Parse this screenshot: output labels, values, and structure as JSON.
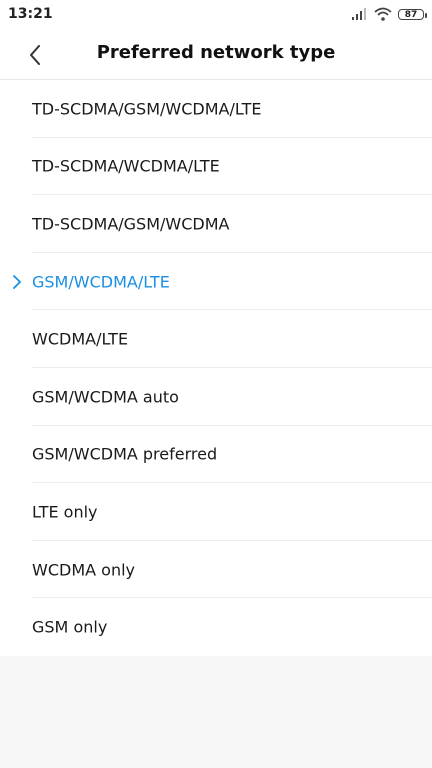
{
  "status_bar": {
    "time": "13:21",
    "battery": "87",
    "signal_icon": "signal-bars-icon",
    "wifi_icon": "wifi-icon"
  },
  "header": {
    "title": "Preferred network type",
    "back_icon": "chevron-left-icon"
  },
  "accent_color": "#1a8fe3",
  "network_types": [
    {
      "label": "TD-SCDMA/GSM/WCDMA/LTE",
      "selected": false
    },
    {
      "label": "TD-SCDMA/WCDMA/LTE",
      "selected": false
    },
    {
      "label": "TD-SCDMA/GSM/WCDMA",
      "selected": false
    },
    {
      "label": "GSM/WCDMA/LTE",
      "selected": true
    },
    {
      "label": "WCDMA/LTE",
      "selected": false
    },
    {
      "label": "GSM/WCDMA auto",
      "selected": false
    },
    {
      "label": "GSM/WCDMA preferred",
      "selected": false
    },
    {
      "label": "LTE only",
      "selected": false
    },
    {
      "label": "WCDMA only",
      "selected": false
    },
    {
      "label": "GSM only",
      "selected": false
    }
  ]
}
